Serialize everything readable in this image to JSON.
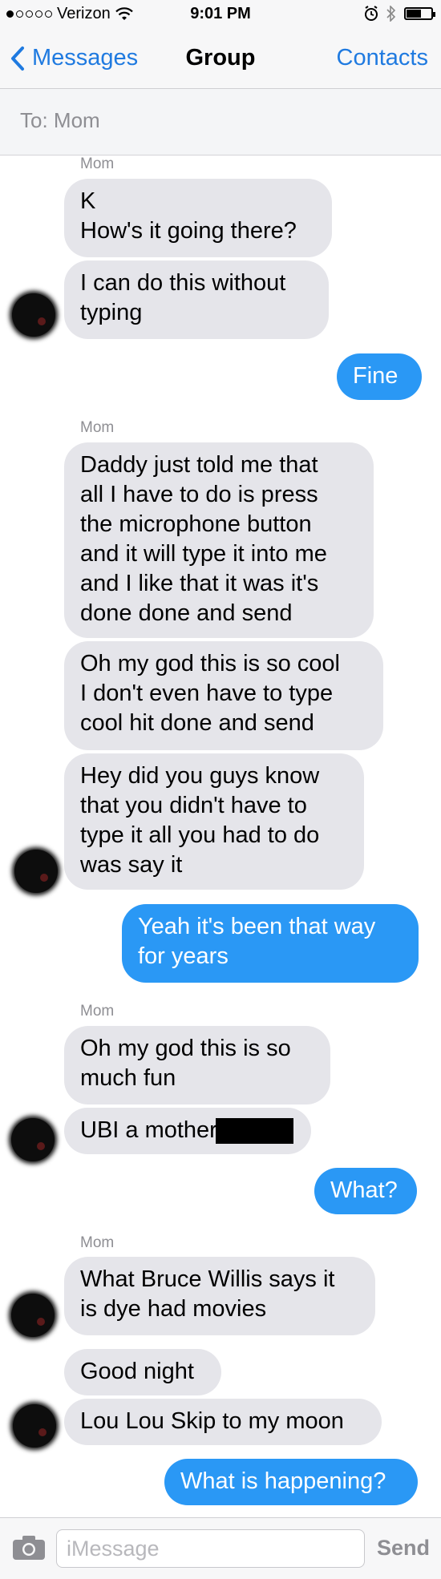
{
  "status_bar": {
    "carrier": "Verizon",
    "time": "9:01 PM",
    "signal_bars_filled": 1,
    "signal_bars_total": 5,
    "battery_level": 0.55
  },
  "nav": {
    "back_label": "Messages",
    "title": "Group",
    "right_label": "Contacts"
  },
  "recipients": {
    "label": "To: Mom"
  },
  "messages": [
    {
      "sender": "Mom"
    },
    {
      "line1": "K",
      "line2": "How's it going there?"
    },
    {
      "line1": "I can do this without",
      "line2": "typing"
    },
    {
      "text": "Fine"
    },
    {
      "sender": "Mom"
    },
    {
      "lines": [
        "Daddy just told me that",
        "all I have to do is press",
        "the microphone button",
        "and it will type it into me",
        "and I like that it was it's",
        "done done and send"
      ]
    },
    {
      "lines": [
        "Oh my god this is so cool",
        "I don't even have to type",
        "cool hit done and send"
      ]
    },
    {
      "lines": [
        "Hey did you guys know",
        "that you didn't have to",
        "type it all you had to do",
        "was say it"
      ]
    },
    {
      "lines": [
        "Yeah it's been that way",
        "for years"
      ]
    },
    {
      "sender": "Mom"
    },
    {
      "lines": [
        "Oh my god this is so",
        "much fun"
      ]
    },
    {
      "text": "UBI a mother"
    },
    {
      "text": "What?"
    },
    {
      "sender": "Mom"
    },
    {
      "lines": [
        "What Bruce Willis says it",
        "is dye had movies"
      ]
    },
    {
      "text": "Good night"
    },
    {
      "text": "Lou Lou Skip to my moon"
    },
    {
      "text": "What is happening?"
    }
  ],
  "input": {
    "placeholder": "iMessage",
    "value": "",
    "send_label": "Send"
  },
  "colors": {
    "accent": "#1f7ae0",
    "outgoing_bubble": "#2a98f5",
    "incoming_bubble": "#e5e5ea"
  }
}
